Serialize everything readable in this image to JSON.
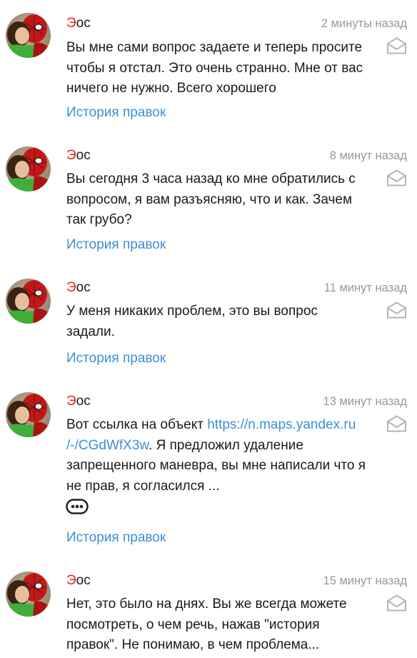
{
  "comments": [
    {
      "author_first": "Э",
      "author_rest": "ос",
      "time": "2 минуты назад",
      "lines": [
        "Вы мне сами вопрос задаете и теперь просите",
        "чтобы я отстал. Это очень странно. Мне от вас",
        "ничего не нужно. Всего хорошего"
      ],
      "history": "История правок"
    },
    {
      "author_first": "Э",
      "author_rest": "ос",
      "time": "8 минут назад",
      "lines": [
        "Вы сегодня 3 часа назад ко мне обратились с",
        "вопросом, я вам разъясняю, что и как. Зачем",
        "так грубо?"
      ],
      "history": "История правок"
    },
    {
      "author_first": "Э",
      "author_rest": "ос",
      "time": "11 минут назад",
      "lines": [
        "У меня никаких проблем, это вы вопрос",
        "задали."
      ],
      "history": "История правок"
    },
    {
      "author_first": "Э",
      "author_rest": "ос",
      "time": "13 минут назад",
      "line1_text": "Вот ссылка на объект ",
      "link_part1": "https://n.maps.yandex.ru",
      "link_part2": "/-/CGdWfX3w",
      "line2_rest": ". Я предложил удаление",
      "lines_after": [
        "запрещенного маневра, вы мне написали что я",
        "не прав, я согласился ..."
      ],
      "more_icon": "ellipsis-icon",
      "history": "История правок"
    },
    {
      "author_first": "Э",
      "author_rest": "ос",
      "time": "15 минут назад",
      "lines": [
        "Нет, это было на днях. Вы же всегда можете",
        "посмотреть, о чем речь, нажав \"история",
        "правок\". Не понимаю, в чем проблема..."
      ]
    }
  ],
  "icons": {
    "reply": "envelope-reply-icon",
    "avatar": "user-avatar"
  },
  "colors": {
    "author_initial": "#e8251a",
    "link": "#3d8fd6",
    "timestamp": "#999999"
  }
}
